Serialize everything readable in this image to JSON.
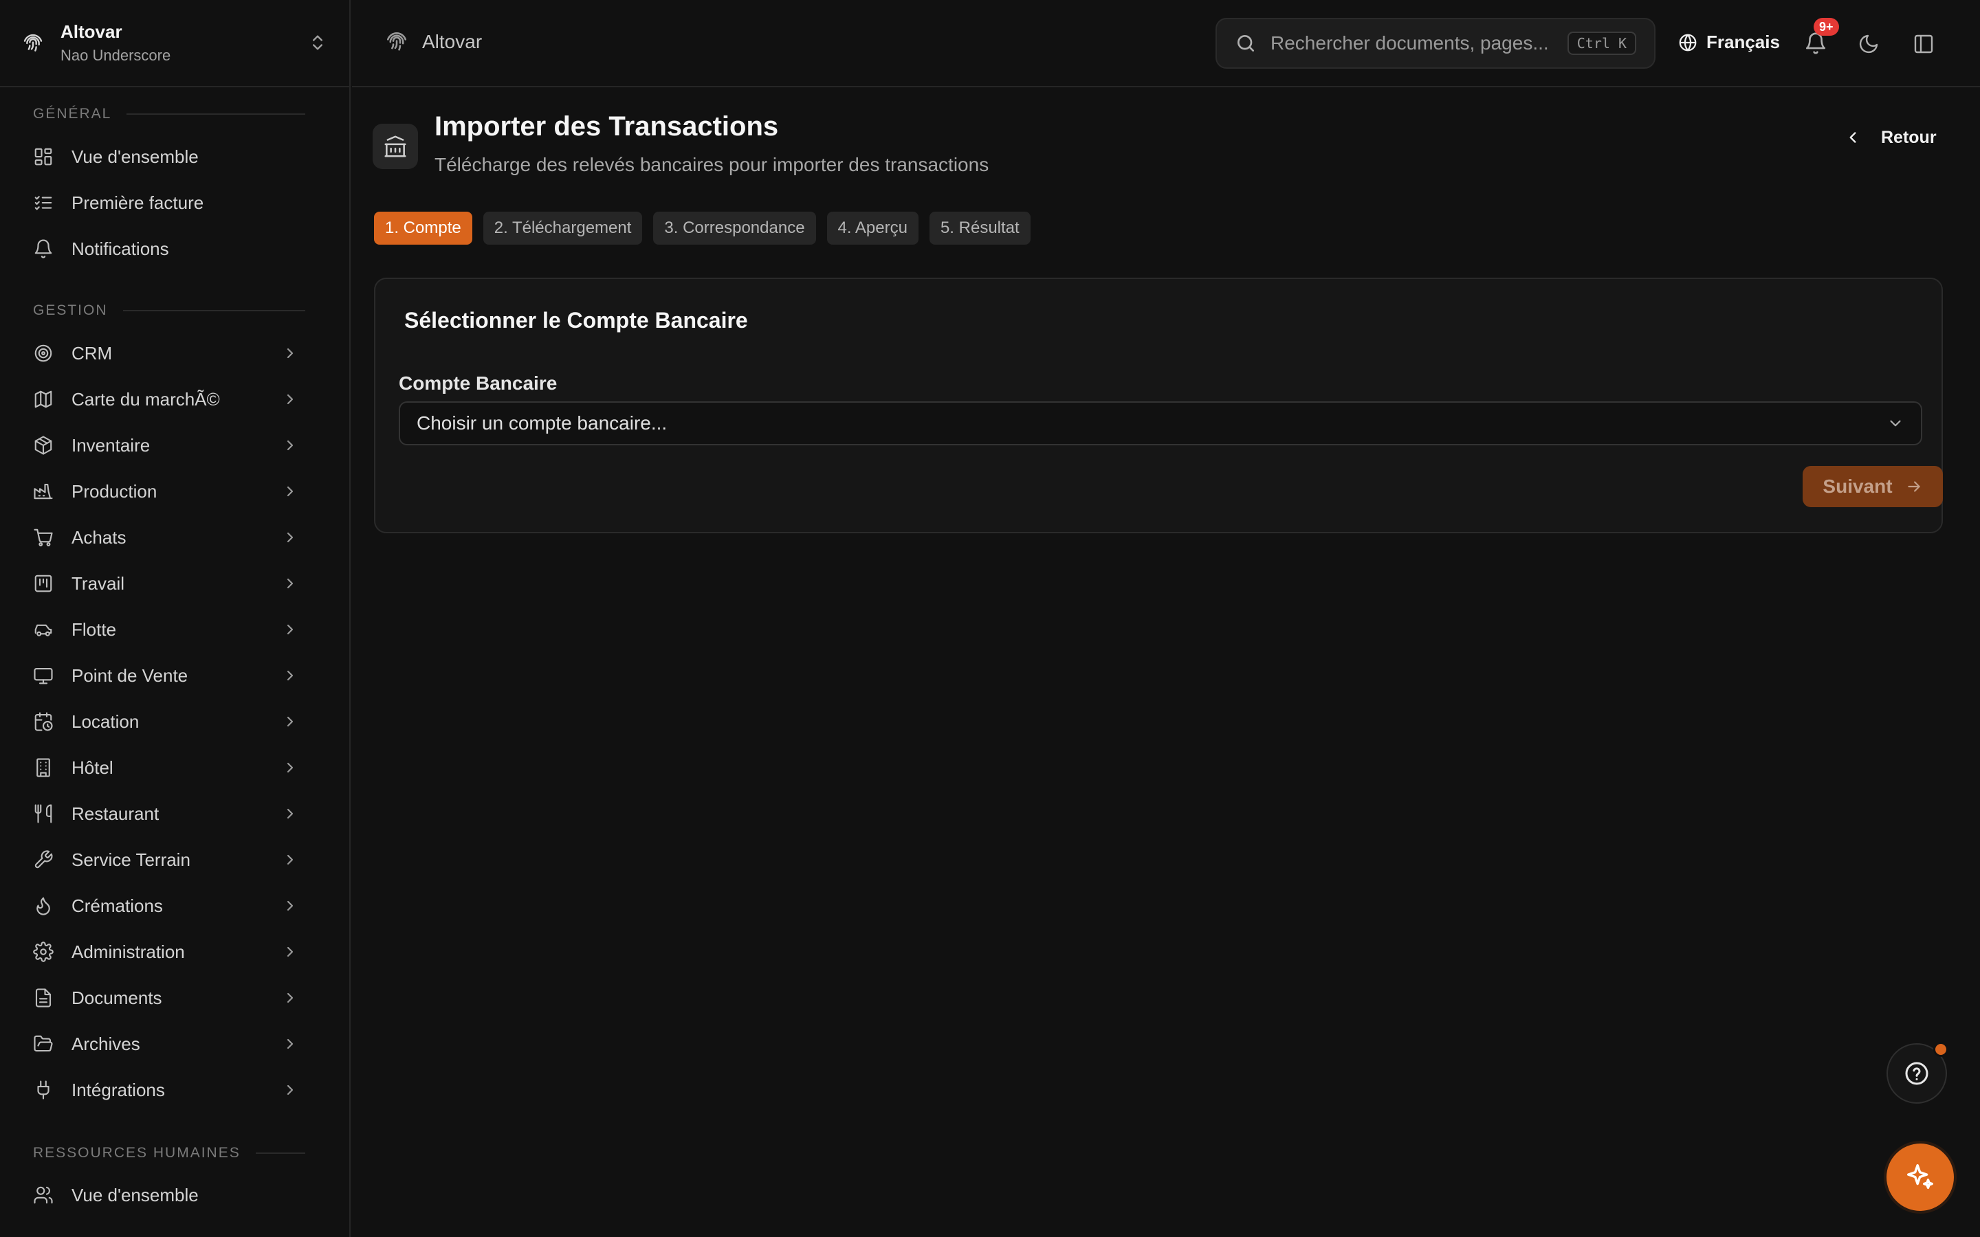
{
  "org": {
    "name": "Altovar",
    "user": "Nao Underscore"
  },
  "sections": {
    "general": "GÉNÉRAL",
    "gestion": "GESTION",
    "rh": "RESSOURCES HUMAINES"
  },
  "nav_general": [
    {
      "label": "Vue d'ensemble",
      "icon": "dashboard-icon"
    },
    {
      "label": "Première facture",
      "icon": "checklist-icon"
    },
    {
      "label": "Notifications",
      "icon": "bell-icon"
    }
  ],
  "nav_gestion": [
    {
      "label": "CRM",
      "icon": "target-icon"
    },
    {
      "label": "Carte du marchÃ©",
      "icon": "map-icon"
    },
    {
      "label": "Inventaire",
      "icon": "package-icon"
    },
    {
      "label": "Production",
      "icon": "factory-icon"
    },
    {
      "label": "Achats",
      "icon": "cart-icon"
    },
    {
      "label": "Travail",
      "icon": "kanban-icon"
    },
    {
      "label": "Flotte",
      "icon": "car-icon"
    },
    {
      "label": "Point de Vente",
      "icon": "monitor-icon"
    },
    {
      "label": "Location",
      "icon": "calendar-clock-icon"
    },
    {
      "label": "Hôtel",
      "icon": "building-icon"
    },
    {
      "label": "Restaurant",
      "icon": "utensils-icon"
    },
    {
      "label": "Service Terrain",
      "icon": "wrench-icon"
    },
    {
      "label": "Crémations",
      "icon": "flame-icon"
    },
    {
      "label": "Administration",
      "icon": "gear-icon"
    },
    {
      "label": "Documents",
      "icon": "file-icon"
    },
    {
      "label": "Archives",
      "icon": "folder-open-icon"
    },
    {
      "label": "Intégrations",
      "icon": "plug-icon"
    }
  ],
  "nav_rh": [
    {
      "label": "Vue d'ensemble",
      "icon": "users-icon"
    }
  ],
  "topbar": {
    "breadcrumb": "Altovar",
    "search_placeholder": "Rechercher documents, pages...",
    "search_shortcut": "Ctrl K",
    "language": "Français",
    "notification_count": "9+"
  },
  "page": {
    "title": "Importer des Transactions",
    "subtitle": "Télécharge des relevés bancaires pour importer des transactions",
    "back_label": "Retour"
  },
  "steps": [
    {
      "label": "1. Compte",
      "active": true
    },
    {
      "label": "2. Téléchargement",
      "active": false
    },
    {
      "label": "3. Correspondance",
      "active": false
    },
    {
      "label": "4. Aperçu",
      "active": false
    },
    {
      "label": "5. Résultat",
      "active": false
    }
  ],
  "card": {
    "title": "Sélectionner le Compte Bancaire",
    "field_label": "Compte Bancaire",
    "select_value": "Choisir un compte bancaire...",
    "next_label": "Suivant"
  },
  "colors": {
    "accent": "#d9641c",
    "background": "#111111",
    "badge": "#e53935"
  }
}
